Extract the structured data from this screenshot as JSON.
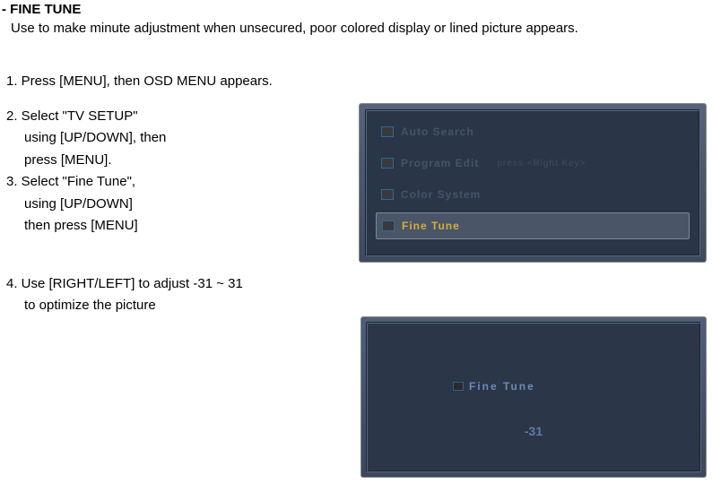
{
  "title": "- FINE TUNE",
  "subtitle": "Use to make minute adjustment when unsecured, poor colored display or lined picture appears.",
  "steps": {
    "s1": "1. Press [MENU], then OSD MENU appears.",
    "s2a": "2. Select \"TV SETUP\"",
    "s2b": "using [UP/DOWN], then",
    "s2c": "press  [MENU].",
    "s3a": "3. Select \"Fine Tune\",",
    "s3b": "using [UP/DOWN]",
    "s3c": "then press  [MENU]",
    "s4a": "4. Use [RIGHT/LEFT] to adjust -31 ~ 31",
    "s4b": "to optimize the picture"
  },
  "osd1": {
    "item1": "Auto  Search",
    "item2": "Program  Edit",
    "item2hint": "press  <Right  Key>",
    "item3": "Color  System",
    "item4": "Fine  Tune"
  },
  "osd2": {
    "label": "Fine  Tune",
    "value": "-31"
  }
}
